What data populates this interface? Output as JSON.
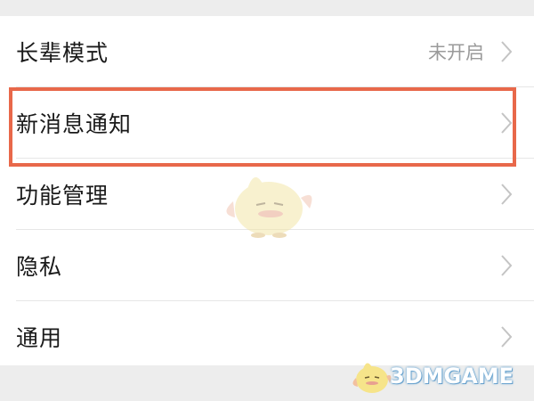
{
  "settings": {
    "items": [
      {
        "label": "长辈模式",
        "value": "未开启"
      },
      {
        "label": "新消息通知",
        "value": ""
      },
      {
        "label": "功能管理",
        "value": ""
      },
      {
        "label": "隐私",
        "value": ""
      },
      {
        "label": "通用",
        "value": ""
      }
    ],
    "highlighted_item": "新消息通知"
  },
  "watermark": {
    "text": "3DMGAME"
  },
  "colors": {
    "page_background": "#ededed",
    "row_background": "#ffffff",
    "label_text": "#1a1a1a",
    "value_text": "#9a9a9a",
    "chevron": "#c4c4c4",
    "highlight_border": "#e8684a"
  },
  "icons": {
    "row_chevron": "chevron-right-icon",
    "mascot": "mascot-bird-icon"
  }
}
